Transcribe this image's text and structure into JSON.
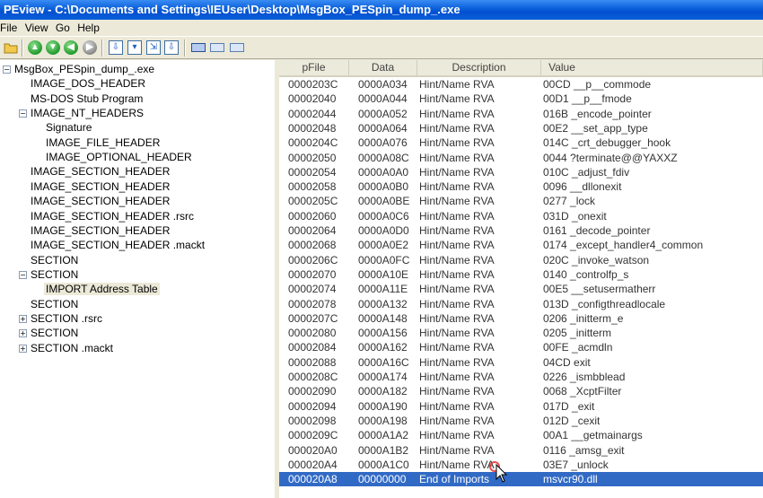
{
  "window": {
    "title": "PEview - C:\\Documents and Settings\\IEUser\\Desktop\\MsgBox_PESpin_dump_.exe"
  },
  "menu": [
    "File",
    "View",
    "Go",
    "Help"
  ],
  "toolbar": {
    "icons": [
      "open-folder-icon",
      "up-arrow-icon",
      "down-arrow-icon",
      "back-arrow-icon",
      "forward-arrow-icon",
      "save-section-icon",
      "save-data-icon",
      "export-icon",
      "import-icon",
      "view-hex-icon",
      "view-list-icon",
      "view-detail-icon"
    ]
  },
  "tree": [
    {
      "label": "MsgBox_PESpin_dump_.exe",
      "level": 0,
      "expander": "-"
    },
    {
      "label": "IMAGE_DOS_HEADER",
      "level": 1,
      "expander": ""
    },
    {
      "label": "MS-DOS Stub Program",
      "level": 1,
      "expander": ""
    },
    {
      "label": "IMAGE_NT_HEADERS",
      "level": 1,
      "expander": "-"
    },
    {
      "label": "Signature",
      "level": 2,
      "expander": ""
    },
    {
      "label": "IMAGE_FILE_HEADER",
      "level": 2,
      "expander": ""
    },
    {
      "label": "IMAGE_OPTIONAL_HEADER",
      "level": 2,
      "expander": ""
    },
    {
      "label": "IMAGE_SECTION_HEADER",
      "level": 1,
      "expander": ""
    },
    {
      "label": "IMAGE_SECTION_HEADER",
      "level": 1,
      "expander": ""
    },
    {
      "label": "IMAGE_SECTION_HEADER",
      "level": 1,
      "expander": ""
    },
    {
      "label": "IMAGE_SECTION_HEADER .rsrc",
      "level": 1,
      "expander": ""
    },
    {
      "label": "IMAGE_SECTION_HEADER",
      "level": 1,
      "expander": ""
    },
    {
      "label": "IMAGE_SECTION_HEADER .mackt",
      "level": 1,
      "expander": ""
    },
    {
      "label": "SECTION",
      "level": 1,
      "expander": ""
    },
    {
      "label": "SECTION",
      "level": 1,
      "expander": "-"
    },
    {
      "label": "IMPORT Address Table",
      "level": 2,
      "expander": "",
      "selected": true
    },
    {
      "label": "SECTION",
      "level": 1,
      "expander": ""
    },
    {
      "label": "SECTION .rsrc",
      "level": 1,
      "expander": "+"
    },
    {
      "label": "SECTION",
      "level": 1,
      "expander": "+"
    },
    {
      "label": "SECTION .mackt",
      "level": 1,
      "expander": "+"
    }
  ],
  "columns": [
    "pFile",
    "Data",
    "Description",
    "Value"
  ],
  "rows": [
    [
      "0000203C",
      "0000A034",
      "Hint/Name RVA",
      "00CD  __p__commode"
    ],
    [
      "00002040",
      "0000A044",
      "Hint/Name RVA",
      "00D1  __p__fmode"
    ],
    [
      "00002044",
      "0000A052",
      "Hint/Name RVA",
      "016B  _encode_pointer"
    ],
    [
      "00002048",
      "0000A064",
      "Hint/Name RVA",
      "00E2  __set_app_type"
    ],
    [
      "0000204C",
      "0000A076",
      "Hint/Name RVA",
      "014C  _crt_debugger_hook"
    ],
    [
      "00002050",
      "0000A08C",
      "Hint/Name RVA",
      "0044  ?terminate@@YAXXZ"
    ],
    [
      "00002054",
      "0000A0A0",
      "Hint/Name RVA",
      "010C  _adjust_fdiv"
    ],
    [
      "00002058",
      "0000A0B0",
      "Hint/Name RVA",
      "0096  __dllonexit"
    ],
    [
      "0000205C",
      "0000A0BE",
      "Hint/Name RVA",
      "0277  _lock"
    ],
    [
      "00002060",
      "0000A0C6",
      "Hint/Name RVA",
      "031D  _onexit"
    ],
    [
      "00002064",
      "0000A0D0",
      "Hint/Name RVA",
      "0161  _decode_pointer"
    ],
    [
      "00002068",
      "0000A0E2",
      "Hint/Name RVA",
      "0174  _except_handler4_common"
    ],
    [
      "0000206C",
      "0000A0FC",
      "Hint/Name RVA",
      "020C  _invoke_watson"
    ],
    [
      "00002070",
      "0000A10E",
      "Hint/Name RVA",
      "0140  _controlfp_s"
    ],
    [
      "00002074",
      "0000A11E",
      "Hint/Name RVA",
      "00E5  __setusermatherr"
    ],
    [
      "00002078",
      "0000A132",
      "Hint/Name RVA",
      "013D  _configthreadlocale"
    ],
    [
      "0000207C",
      "0000A148",
      "Hint/Name RVA",
      "0206  _initterm_e"
    ],
    [
      "00002080",
      "0000A156",
      "Hint/Name RVA",
      "0205  _initterm"
    ],
    [
      "00002084",
      "0000A162",
      "Hint/Name RVA",
      "00FE  _acmdln"
    ],
    [
      "00002088",
      "0000A16C",
      "Hint/Name RVA",
      "04CD  exit"
    ],
    [
      "0000208C",
      "0000A174",
      "Hint/Name RVA",
      "0226  _ismbblead"
    ],
    [
      "00002090",
      "0000A182",
      "Hint/Name RVA",
      "0068  _XcptFilter"
    ],
    [
      "00002094",
      "0000A190",
      "Hint/Name RVA",
      "017D  _exit"
    ],
    [
      "00002098",
      "0000A198",
      "Hint/Name RVA",
      "012D  _cexit"
    ],
    [
      "0000209C",
      "0000A1A2",
      "Hint/Name RVA",
      "00A1  __getmainargs"
    ],
    [
      "000020A0",
      "0000A1B2",
      "Hint/Name RVA",
      "0116  _amsg_exit"
    ],
    [
      "000020A4",
      "0000A1C0",
      "Hint/Name RVA",
      "03E7  _unlock"
    ],
    [
      "000020A8",
      "00000000",
      "End of Imports",
      "msvcr90.dll"
    ]
  ],
  "selected_row": 27,
  "colors": {
    "title_bar": "#0a5fd9",
    "selection": "#316ac5",
    "window_bg": "#ece9d8"
  }
}
